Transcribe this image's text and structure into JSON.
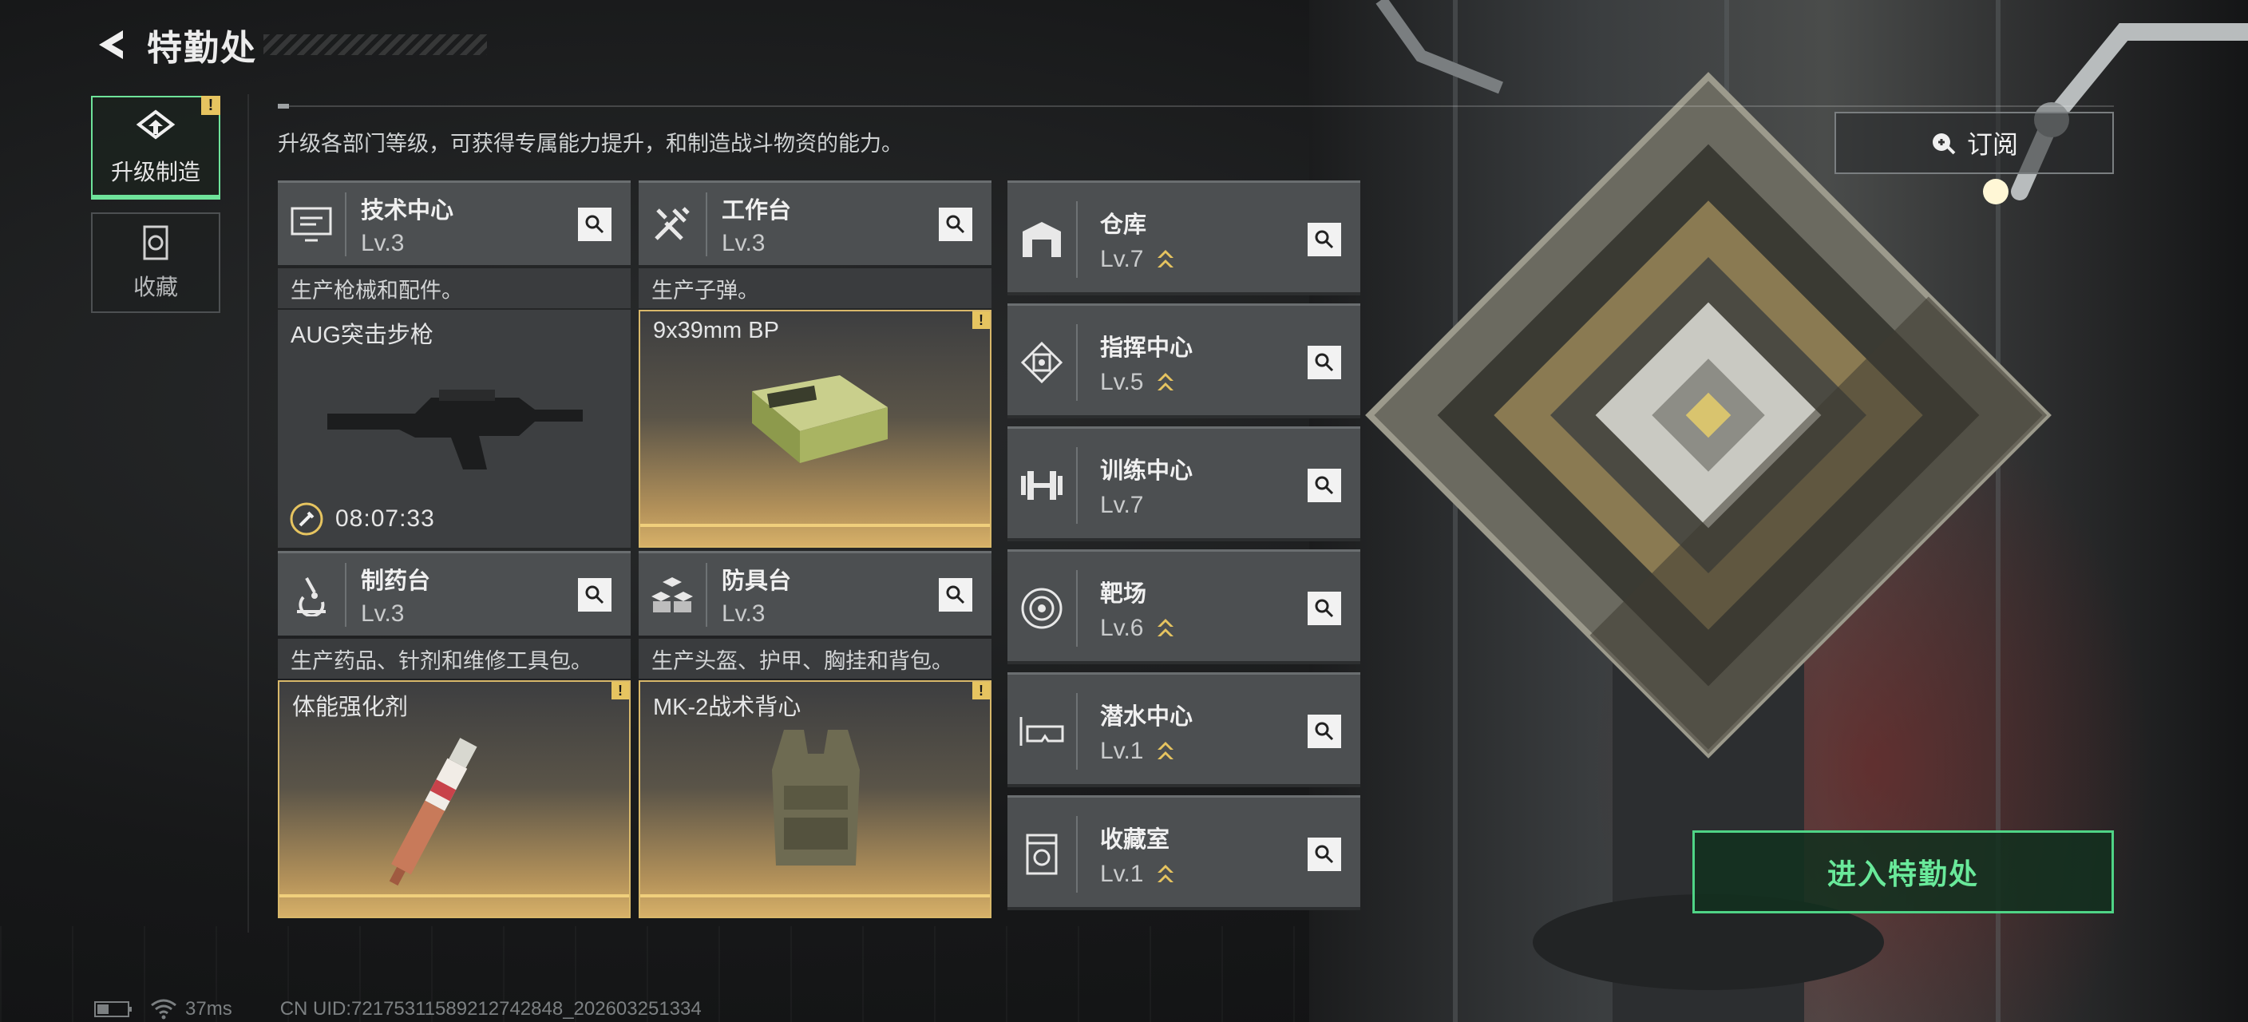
{
  "header": {
    "title": "特勤处"
  },
  "nav": {
    "items": [
      {
        "label": "升级制造",
        "active": true,
        "alert": "!"
      },
      {
        "label": "收藏",
        "active": false
      }
    ]
  },
  "description": "升级各部门等级，可获得专属能力提升，和制造战斗物资的能力。",
  "production": [
    {
      "name": "技术中心",
      "level": "Lv.3",
      "desc": "生产枪械和配件。",
      "item": "AUG突击步枪",
      "timer": "08:07:33",
      "icon": "monitor-icon"
    },
    {
      "name": "工作台",
      "level": "Lv.3",
      "desc": "生产子弹。",
      "item": "9x39mm BP",
      "alert": "!",
      "icon": "tools-icon"
    },
    {
      "name": "制药台",
      "level": "Lv.3",
      "desc": "生产药品、针剂和维修工具包。",
      "item": "体能强化剂",
      "alert": "!",
      "icon": "microscope-icon"
    },
    {
      "name": "防具台",
      "level": "Lv.3",
      "desc": "生产头盔、护甲、胸挂和背包。",
      "item": "MK-2战术背心",
      "alert": "!",
      "icon": "armor-blocks-icon"
    }
  ],
  "facilities": [
    {
      "name": "仓库",
      "level": "Lv.7",
      "upgrade": true,
      "icon": "warehouse-icon"
    },
    {
      "name": "指挥中心",
      "level": "Lv.5",
      "upgrade": true,
      "icon": "chip-icon"
    },
    {
      "name": "训练中心",
      "level": "Lv.7",
      "upgrade": false,
      "icon": "dumbbell-icon"
    },
    {
      "name": "靶场",
      "level": "Lv.6",
      "upgrade": true,
      "icon": "target-icon"
    },
    {
      "name": "潜水中心",
      "level": "Lv.1",
      "upgrade": true,
      "icon": "diving-mask-icon"
    },
    {
      "name": "收藏室",
      "level": "Lv.1",
      "upgrade": true,
      "icon": "collection-icon"
    }
  ],
  "right": {
    "subscribe_label": "订阅",
    "enter_label": "进入特勤处"
  },
  "status": {
    "ping": "37ms",
    "uid": "CN UID:7217531158921274284​8_2026032513​34"
  },
  "colors": {
    "accent_green": "#4fd486",
    "gold": "#d8b86a",
    "upgrade_gold": "#e6c460"
  }
}
